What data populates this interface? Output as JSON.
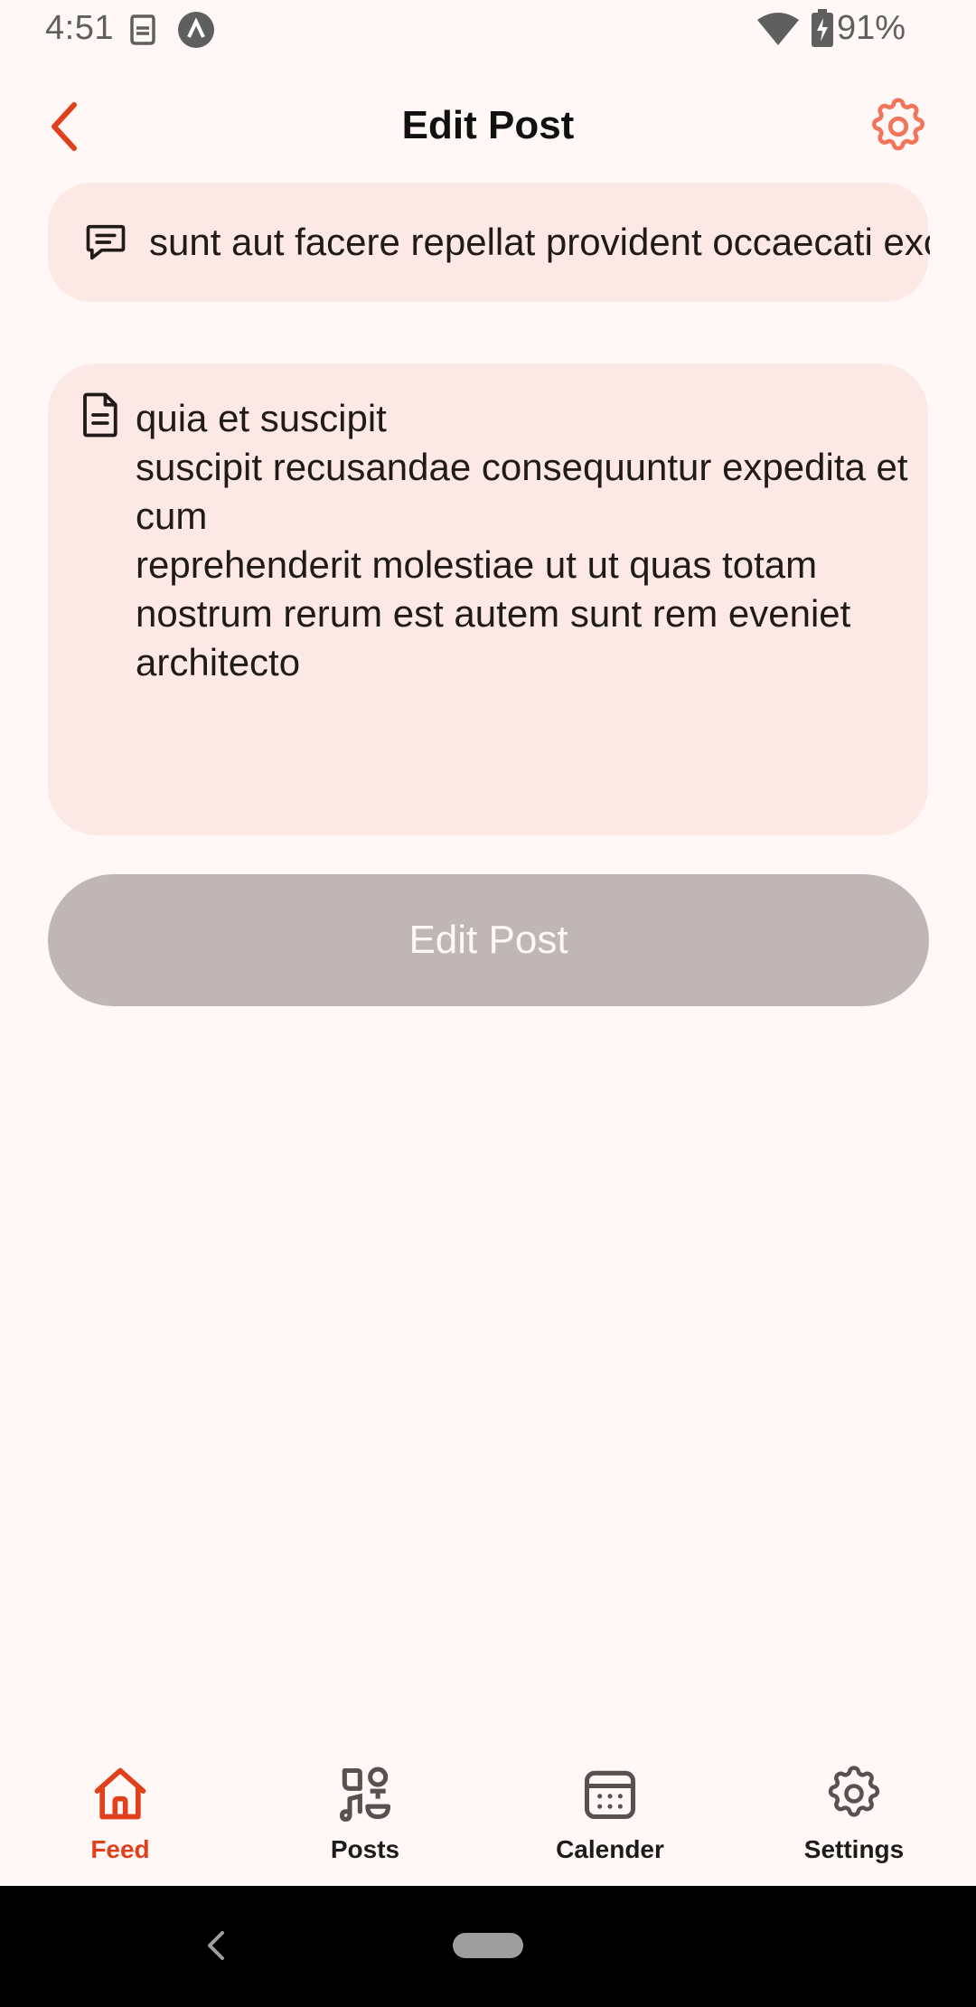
{
  "status_bar": {
    "time": "4:51",
    "battery": "91%",
    "icons": [
      "data-saver-icon",
      "app-notification-icon",
      "wifi-icon",
      "battery-charging-icon"
    ]
  },
  "app_bar": {
    "title": "Edit Post",
    "back_icon": "chevron-left-icon",
    "settings_icon": "gear-icon"
  },
  "form": {
    "title_value": "sunt aut facere repellat provident occaecati excepturi optio reprehenderit",
    "title_icon": "message-icon",
    "body_value": "quia et suscipit\nsuscipit recusandae consequuntur expedita et cum\nreprehenderit molestiae ut ut quas totam\nnostrum rerum est autem sunt rem eveniet architecto",
    "body_icon": "document-icon",
    "submit_label": "Edit Post"
  },
  "bottom_nav": {
    "items": [
      {
        "label": "Feed",
        "icon": "home-icon",
        "active": true
      },
      {
        "label": "Posts",
        "icon": "posts-icon",
        "active": false
      },
      {
        "label": "Calender",
        "icon": "calendar-icon",
        "active": false
      },
      {
        "label": "Settings",
        "icon": "gear-icon",
        "active": false
      }
    ]
  },
  "colors": {
    "accent": "#E0401C",
    "background": "#FFF8F6",
    "field_fill": "#FCE8E4",
    "button_disabled": "#BFB6B5"
  }
}
